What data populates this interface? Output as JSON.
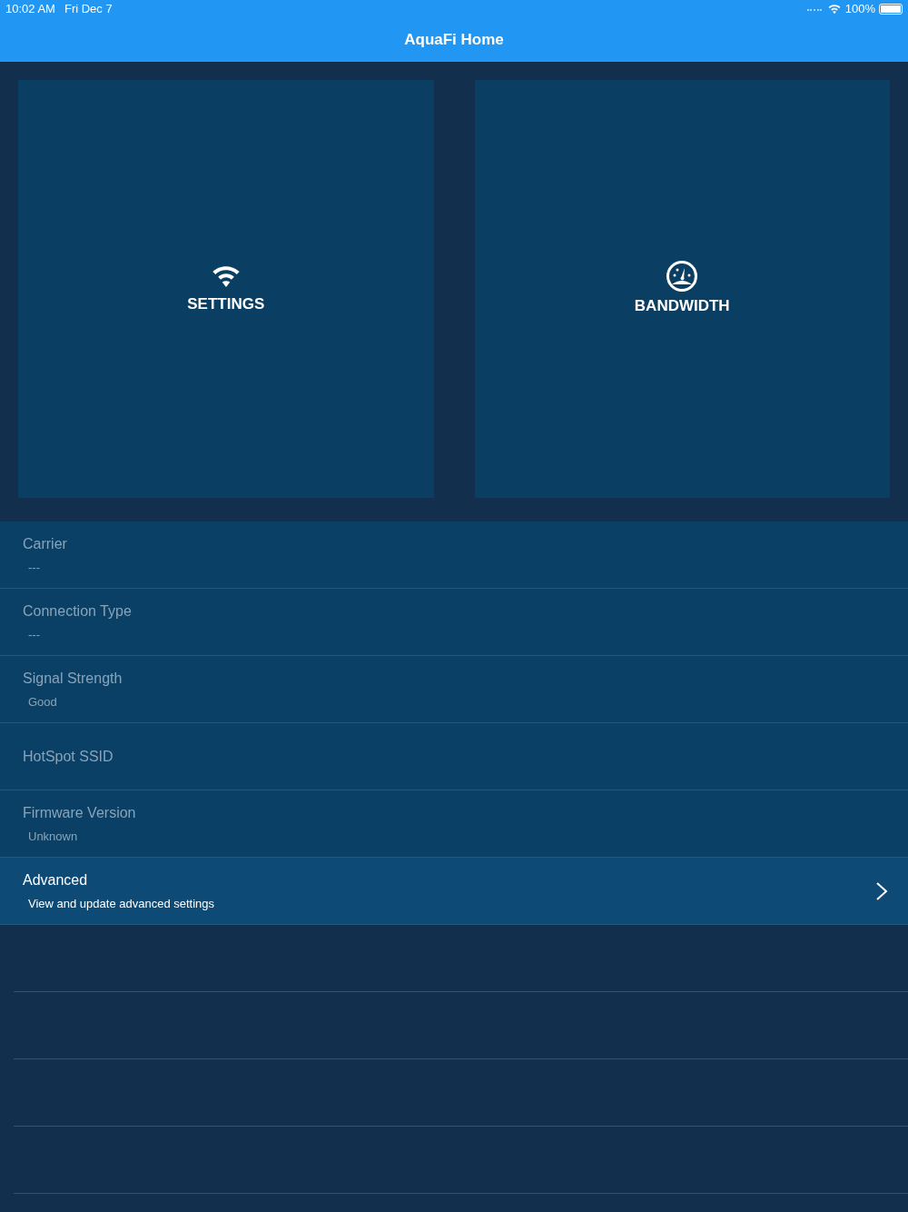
{
  "status_bar": {
    "time": "10:02 AM",
    "date": "Fri Dec 7",
    "battery": "100%"
  },
  "nav": {
    "title": "AquaFi Home"
  },
  "tiles": [
    {
      "kind": "wifi",
      "label": "SETTINGS"
    },
    {
      "kind": "gauge",
      "label": "BANDWIDTH"
    }
  ],
  "rows": [
    {
      "title": "Carrier",
      "subtitle": "---",
      "disabled": true
    },
    {
      "title": "Connection Type",
      "subtitle": "---",
      "disabled": true
    },
    {
      "title": "Signal Strength",
      "subtitle": "Good",
      "disabled": true
    },
    {
      "title": "HotSpot SSID",
      "disabled": true
    },
    {
      "title": "Firmware Version",
      "subtitle": "Unknown",
      "disabled": true
    },
    {
      "title": "Advanced",
      "subtitle": "View and update advanced settings",
      "disabled": false
    }
  ]
}
